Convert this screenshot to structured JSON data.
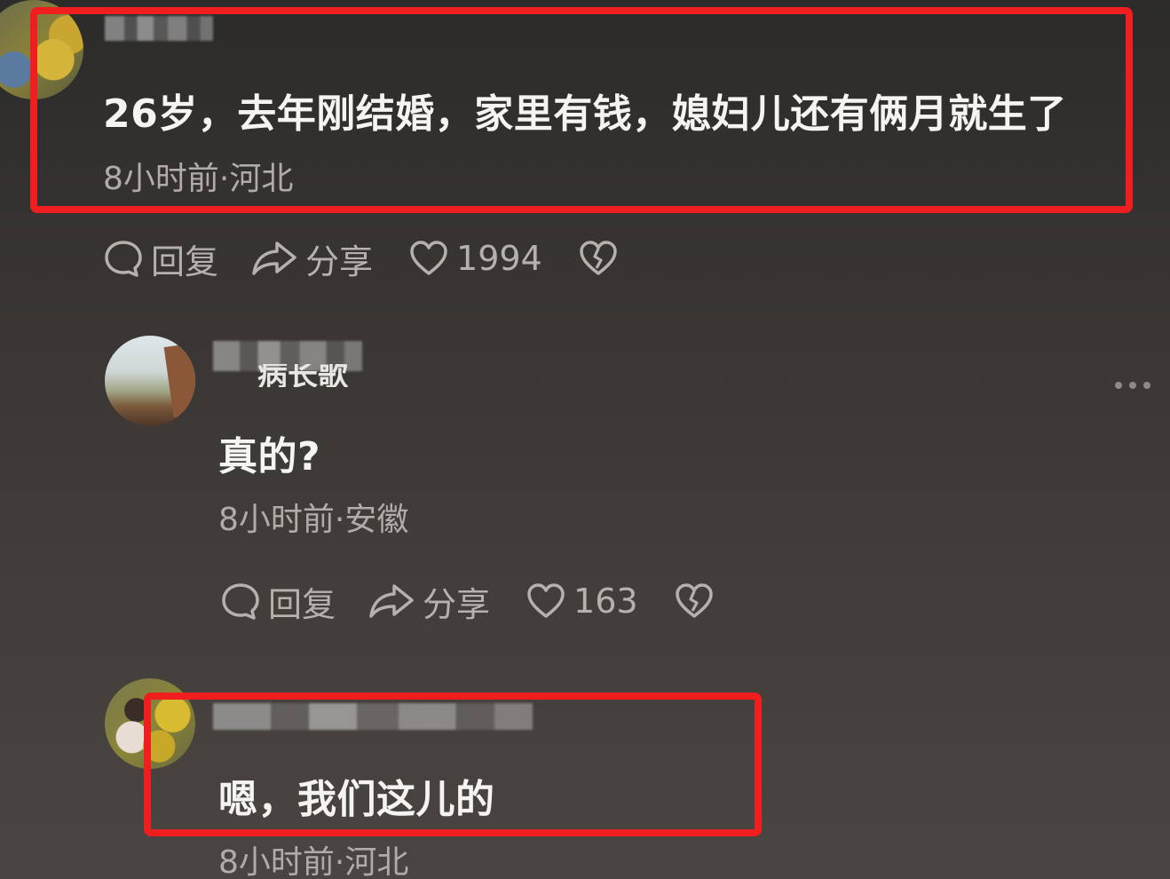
{
  "comments": [
    {
      "text": "26岁，去年刚结婚，家里有钱，媳妇儿还有俩月就生了",
      "meta": "8小时前·河北",
      "actions": {
        "reply_label": "回复",
        "share_label": "分享",
        "like_count": "1994"
      }
    },
    {
      "username_visible_fragment": "病长歌",
      "text": "真的?",
      "meta": "8小时前·安徽",
      "actions": {
        "reply_label": "回复",
        "share_label": "分享",
        "like_count": "163"
      }
    },
    {
      "text": "嗯，我们这儿的",
      "meta": "8小时前·河北"
    }
  ],
  "icons": {
    "reply": "speech-bubble-icon",
    "share": "share-arrow-icon",
    "like": "heart-icon",
    "dislike": "broken-heart-icon",
    "more": "more-dots-icon"
  },
  "colors": {
    "highlight_box": "#f01e1e",
    "primary_text": "#f6f4f2",
    "secondary_text": "#b1aca7"
  }
}
